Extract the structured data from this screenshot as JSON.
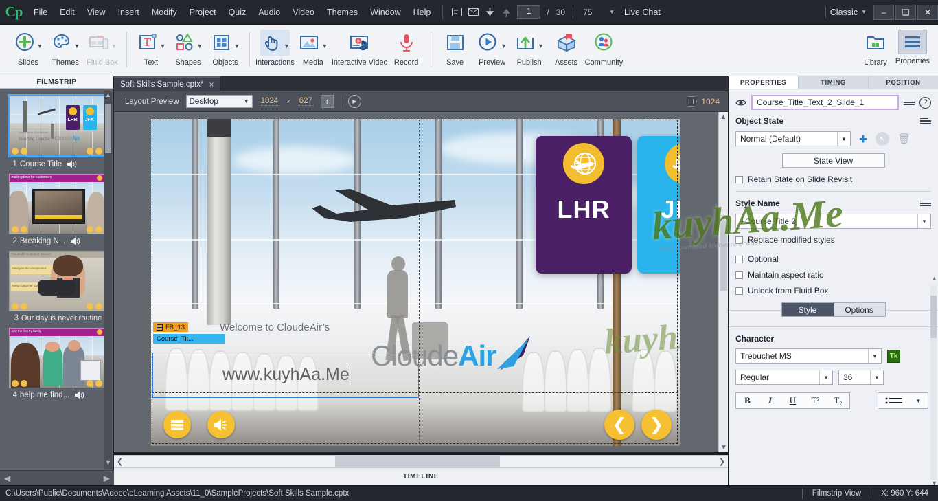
{
  "menubar": {
    "logo": "Cp",
    "items": [
      "File",
      "Edit",
      "View",
      "Insert",
      "Modify",
      "Project",
      "Quiz",
      "Audio",
      "Video",
      "Themes",
      "Window",
      "Help"
    ],
    "icons": [
      "presentation-icon",
      "mail-icon",
      "download-arrow-icon",
      "upload-arrow-icon"
    ],
    "slide_current": "1",
    "slide_sep": "/",
    "slide_total": "30",
    "zoom_value": "75",
    "live_chat": "Live Chat",
    "workspace": "Classic",
    "window_buttons": {
      "minimize": "–",
      "maximize": "❑",
      "close": "✕"
    }
  },
  "toolbar": {
    "groups": [
      {
        "label": "Slides",
        "icon": "add-slide-icon",
        "caret": true,
        "disabled": false
      },
      {
        "label": "Themes",
        "icon": "palette-icon",
        "caret": true,
        "disabled": false
      },
      {
        "label": "Fluid Box",
        "icon": "fluid-box-icon",
        "caret": true,
        "disabled": true
      },
      {
        "label": "Text",
        "icon": "text-icon",
        "caret": true,
        "disabled": false
      },
      {
        "label": "Shapes",
        "icon": "shapes-icon",
        "caret": true,
        "disabled": false
      },
      {
        "label": "Objects",
        "icon": "objects-icon",
        "caret": true,
        "disabled": false
      },
      {
        "label": "Interactions",
        "icon": "hand-click-icon",
        "caret": true,
        "disabled": false
      },
      {
        "label": "Media",
        "icon": "media-image-icon",
        "caret": true,
        "disabled": false
      },
      {
        "label": "Interactive Video",
        "icon": "interactive-video-icon",
        "caret": false,
        "disabled": false
      },
      {
        "label": "Record",
        "icon": "microphone-icon",
        "caret": false,
        "disabled": false
      },
      {
        "label": "Save",
        "icon": "floppy-disk-icon",
        "caret": false,
        "disabled": false
      },
      {
        "label": "Preview",
        "icon": "play-circle-icon",
        "caret": true,
        "disabled": false
      },
      {
        "label": "Publish",
        "icon": "publish-upload-icon",
        "caret": true,
        "disabled": false
      },
      {
        "label": "Assets",
        "icon": "assets-box-icon",
        "caret": false,
        "disabled": false
      },
      {
        "label": "Community",
        "icon": "community-people-icon",
        "caret": false,
        "disabled": false
      },
      {
        "label": "Library",
        "icon": "library-folder-icon",
        "caret": false,
        "disabled": false
      },
      {
        "label": "Properties",
        "icon": "properties-lines-icon",
        "caret": false,
        "disabled": false
      }
    ]
  },
  "filmstrip": {
    "header": "FILMSTRIP",
    "slides": [
      {
        "number": "1",
        "title": "Course Title",
        "has_audio": true,
        "selected": true
      },
      {
        "number": "2",
        "title": "Breaking N...",
        "has_audio": true,
        "selected": false
      },
      {
        "number": "3",
        "title": "Our day is never routine",
        "has_audio": false,
        "selected": false
      },
      {
        "number": "4",
        "title": "help me find...",
        "has_audio": true,
        "selected": false
      }
    ]
  },
  "document": {
    "tab_title": "Soft Skills Sample.cptx*",
    "close_glyph": "×"
  },
  "layout_preview": {
    "label": "Layout Preview",
    "device": "Desktop",
    "width": "1024",
    "multiply": "×",
    "height": "627",
    "add_glyph": "+",
    "play_glyph": "▶",
    "ruler_value": "1024"
  },
  "slide": {
    "welcome_text": "Welcome to CloudeAir’s",
    "editing_text": "www.kuyhAa.Me",
    "logo_part1": "Cloude",
    "logo_part2": "Air",
    "signs": [
      {
        "code": "LHR",
        "color": "#4b1f66"
      },
      {
        "code": "JFK",
        "color": "#28b4ea"
      }
    ],
    "fluid_box_tag": "FB_13",
    "object_tag": "Course_Tit...",
    "playbar": {
      "menu": "menu-icon",
      "audio": "audio-icon",
      "prev": "❮",
      "next": "❯"
    }
  },
  "watermark": {
    "main": "kuyhAa.Me",
    "sub": "Free download software gratis"
  },
  "timeline": {
    "label": "TIMELINE"
  },
  "properties": {
    "tabs": [
      {
        "label": "PROPERTIES",
        "active": true
      },
      {
        "label": "TIMING",
        "active": false
      },
      {
        "label": "POSITION",
        "active": false
      }
    ],
    "object_name": "Course_Title_Text_2_Slide_1",
    "object_state_title": "Object State",
    "state_value": "Normal (Default)",
    "state_view_button": "State View",
    "retain_state_label": "Retain State on Slide Revisit",
    "style_name_title": "Style Name",
    "style_value": "+Course Title 2",
    "replace_styles_label": "Replace modified styles",
    "optional_label": "Optional",
    "maintain_ratio_label": "Maintain aspect ratio",
    "unlock_fluid_label": "Unlock from Fluid Box",
    "segment": {
      "style": "Style",
      "options": "Options"
    },
    "character_title": "Character",
    "font_family": "Trebuchet MS",
    "tk_badge": "Tk",
    "font_style": "Regular",
    "font_size": "36",
    "format_buttons": [
      "B",
      "I",
      "U",
      "T²",
      "T₂"
    ],
    "list_icon": "bullet-list-icon"
  },
  "statusbar": {
    "path": "C:\\Users\\Public\\Documents\\Adobe\\eLearning Assets\\11_0\\SampleProjects\\Soft Skills Sample.cptx",
    "view_mode": "Filmstrip View",
    "coords": "X: 960 Y: 644"
  }
}
